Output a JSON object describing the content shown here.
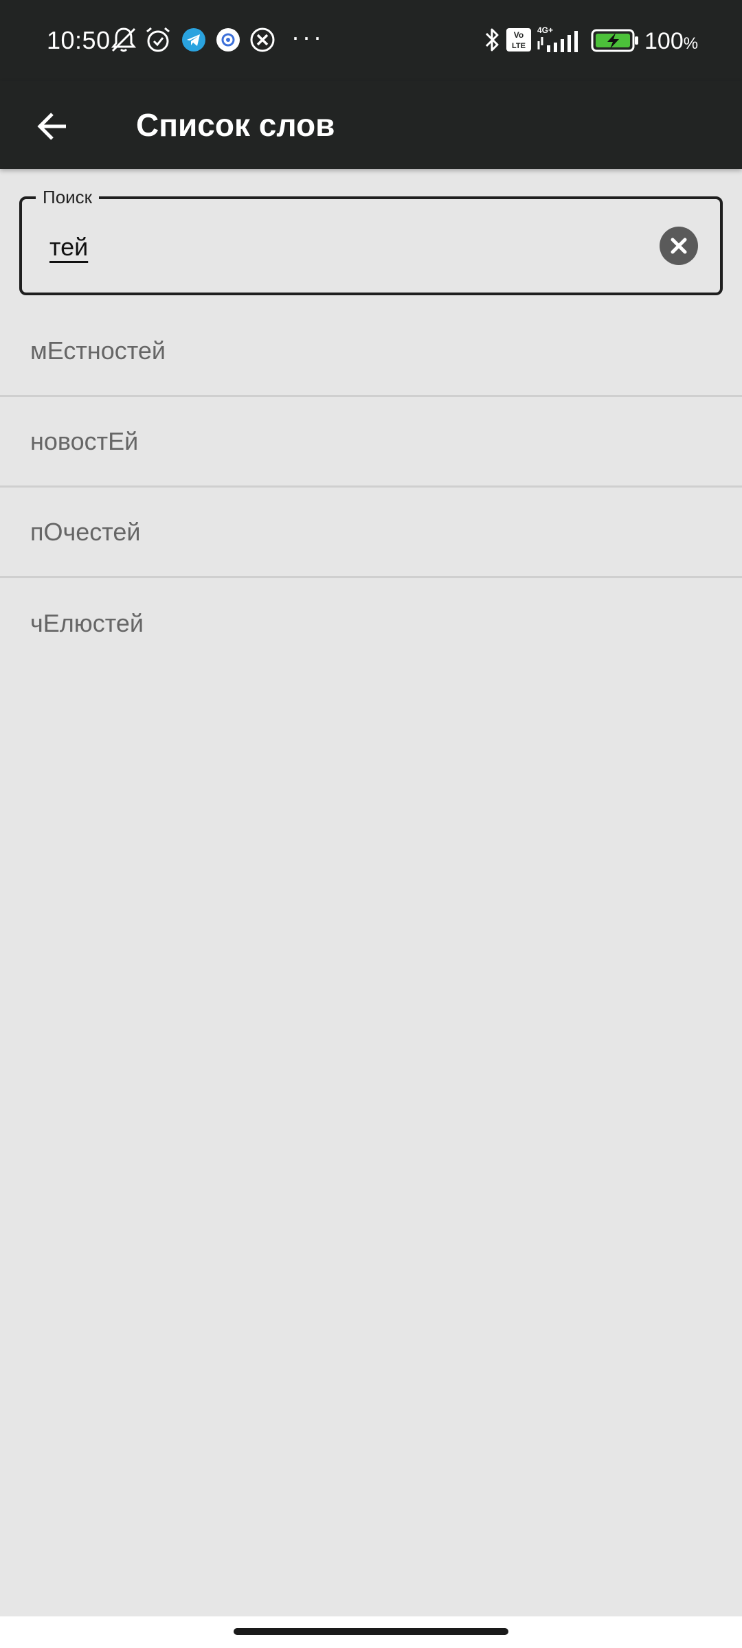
{
  "status_bar": {
    "time": "10:50",
    "battery_level": "100",
    "battery_unit": "%",
    "network": "4G+",
    "volte": "Vo LTE",
    "icons": [
      "bell-off-icon",
      "alarm-icon",
      "telegram-icon",
      "gear-app-icon",
      "close-circle-icon",
      "more-dots-icon",
      "bluetooth-icon",
      "volte-icon",
      "signal-icon",
      "battery-charging-icon"
    ],
    "overflow_dots": "···"
  },
  "app_bar": {
    "title": "Список слов",
    "back_icon": "arrow-left-icon"
  },
  "search": {
    "label": "Поиск",
    "value": "тей",
    "clear_icon": "clear-circle-icon"
  },
  "words": [
    {
      "text": "мЕстностей"
    },
    {
      "text": "новостЕй"
    },
    {
      "text": "пОчестей"
    },
    {
      "text": "чЕлюстей"
    }
  ],
  "colors": {
    "bar_background": "#222423",
    "page_background": "#e6e6e6",
    "word_text": "#666666",
    "divider": "#cfcfcf"
  }
}
